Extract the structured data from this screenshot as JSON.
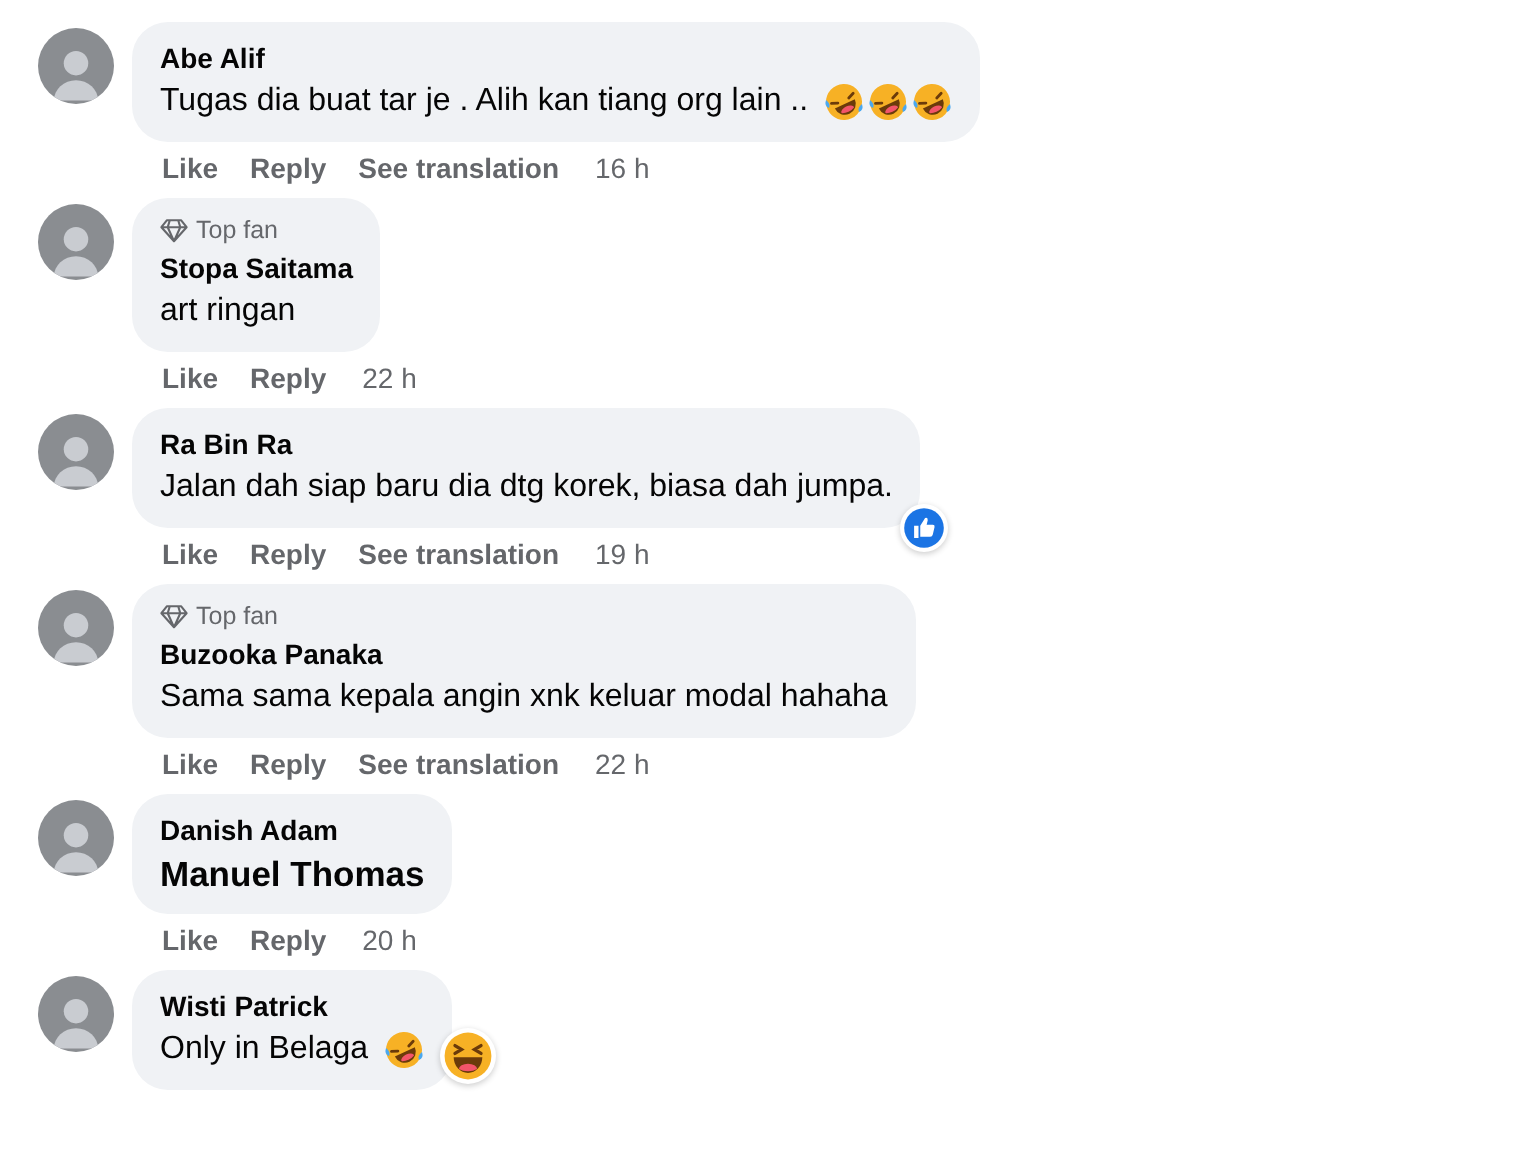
{
  "comments": [
    {
      "author": "Abe Alif",
      "top_fan": false,
      "text": "Tugas dia buat tar je . Alih kan tiang org lain ..",
      "mention": false,
      "emojis": [
        {
          "kind": "rofl"
        },
        {
          "kind": "rofl"
        },
        {
          "kind": "rofl"
        }
      ],
      "actions": [
        "Like",
        "Reply",
        "See translation"
      ],
      "time": "16 h"
    },
    {
      "author": "Stopa Saitama",
      "top_fan": true,
      "badge": "Top fan",
      "text": "art ringan",
      "mention": false,
      "actions": [
        "Like",
        "Reply"
      ],
      "time": "22 h"
    },
    {
      "author": "Ra Bin Ra",
      "top_fan": false,
      "text": "Jalan dah siap baru dia dtg korek, biasa dah jumpa.",
      "mention": false,
      "reaction": {
        "kind": "like"
      },
      "actions": [
        "Like",
        "Reply",
        "See translation"
      ],
      "time": "19 h"
    },
    {
      "author": "Buzooka Panaka",
      "top_fan": true,
      "badge": "Top fan",
      "text": "Sama sama kepala angin xnk keluar modal hahaha",
      "mention": false,
      "actions": [
        "Like",
        "Reply",
        "See translation"
      ],
      "time": "22 h"
    },
    {
      "author": "Danish Adam",
      "top_fan": false,
      "text": "Manuel Thomas",
      "mention": true,
      "actions": [
        "Like",
        "Reply"
      ],
      "time": "20 h"
    },
    {
      "author": "Wisti Patrick",
      "top_fan": false,
      "text": "Only in Belaga",
      "mention": false,
      "emojis": [
        {
          "kind": "rofl"
        }
      ],
      "reaction": {
        "kind": "haha"
      }
    }
  ]
}
